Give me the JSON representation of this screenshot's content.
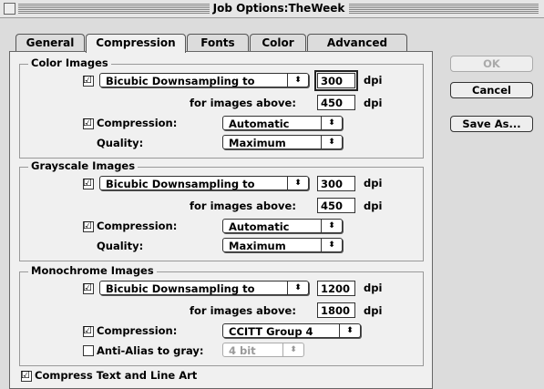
{
  "window": {
    "title": "Job Options:TheWeek"
  },
  "tabs": [
    {
      "label": "General"
    },
    {
      "label": "Compression",
      "active": true
    },
    {
      "label": "Fonts"
    },
    {
      "label": "Color"
    },
    {
      "label": "Advanced"
    }
  ],
  "buttons": {
    "ok": "OK",
    "cancel": "Cancel",
    "save_as": "Save As..."
  },
  "color": {
    "legend": "Color Images",
    "downsample_checked": true,
    "downsample_method": "Bicubic Downsampling to",
    "resolution": "300",
    "dpi": "dpi",
    "above_label": "for images above:",
    "above_value": "450",
    "dpi2": "dpi",
    "compression_label": "Compression:",
    "compression_checked": true,
    "compression_value": "Automatic",
    "quality_label": "Quality:",
    "quality_value": "Maximum"
  },
  "gray": {
    "legend": "Grayscale Images",
    "downsample_checked": true,
    "downsample_method": "Bicubic Downsampling to",
    "resolution": "300",
    "dpi": "dpi",
    "above_label": "for images above:",
    "above_value": "450",
    "dpi2": "dpi",
    "compression_label": "Compression:",
    "compression_checked": true,
    "compression_value": "Automatic",
    "quality_label": "Quality:",
    "quality_value": "Maximum"
  },
  "mono": {
    "legend": "Monochrome Images",
    "downsample_checked": true,
    "downsample_method": "Bicubic Downsampling to",
    "resolution": "1200",
    "dpi": "dpi",
    "above_label": "for images above:",
    "above_value": "1800",
    "dpi2": "dpi",
    "compression_label": "Compression:",
    "compression_checked": true,
    "compression_value": "CCITT Group 4",
    "antialias_label": "Anti-Alias to gray:",
    "antialias_checked": false,
    "antialias_value": "4 bit"
  },
  "compress_text": {
    "label": "Compress Text and Line Art",
    "checked": true
  },
  "icons": {
    "checkmark": "☑",
    "popup_arrow": "⬍"
  }
}
